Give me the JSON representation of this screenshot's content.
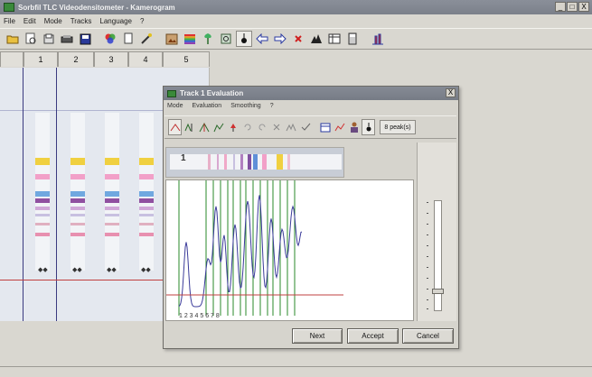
{
  "window": {
    "title": "Sorbfil TLC Videodensitometer - Kamerogram",
    "minimize_label": "_",
    "maximize_label": "□",
    "close_label": "X"
  },
  "menu": [
    "File",
    "Edit",
    "Mode",
    "Tracks",
    "Language",
    "?"
  ],
  "lanes": {
    "tabs": [
      "1",
      "2",
      "3",
      "4",
      "5"
    ]
  },
  "dialog": {
    "title": "Track 1 Evaluation",
    "close_label": "X",
    "menu": [
      "Mode",
      "Evaluation",
      "Smoothing",
      "?"
    ],
    "peaks": "8 peak(s)",
    "strip_label": "1",
    "axis_text": "1  2  3  4  5  6  7  8",
    "buttons": {
      "next": "Next",
      "accept": "Accept",
      "cancel": "Cancel"
    }
  },
  "icons": {
    "main_toolbar": [
      "open-folder-icon",
      "preview-icon",
      "open-icon",
      "scanner-icon",
      "save-icon",
      "colors-icon",
      "document-icon",
      "wand-icon",
      "image-edit-icon",
      "rainbow-icon",
      "tree-icon",
      "grid-settings-icon",
      "spot-icon",
      "arrow-left-icon",
      "arrow-right-icon",
      "delete-icon",
      "peak-icon",
      "table-icon",
      "calculator-icon",
      "chromatogram-icon"
    ],
    "dialog_toolbar": [
      "baseline-icon",
      "peak-split-icon",
      "peak-a-icon",
      "peak-b-icon",
      "peak-select-icon",
      "undo-icon",
      "redo-icon",
      "delete-peak-icon",
      "auto-peaks-icon",
      "check-icon",
      "table-icon",
      "chart-icon",
      "person-icon",
      "spot-icon"
    ]
  },
  "colors": {
    "accent_line": "#c04040",
    "curve": "#3b3b9a",
    "peak_marker": "#2a8a2a"
  }
}
